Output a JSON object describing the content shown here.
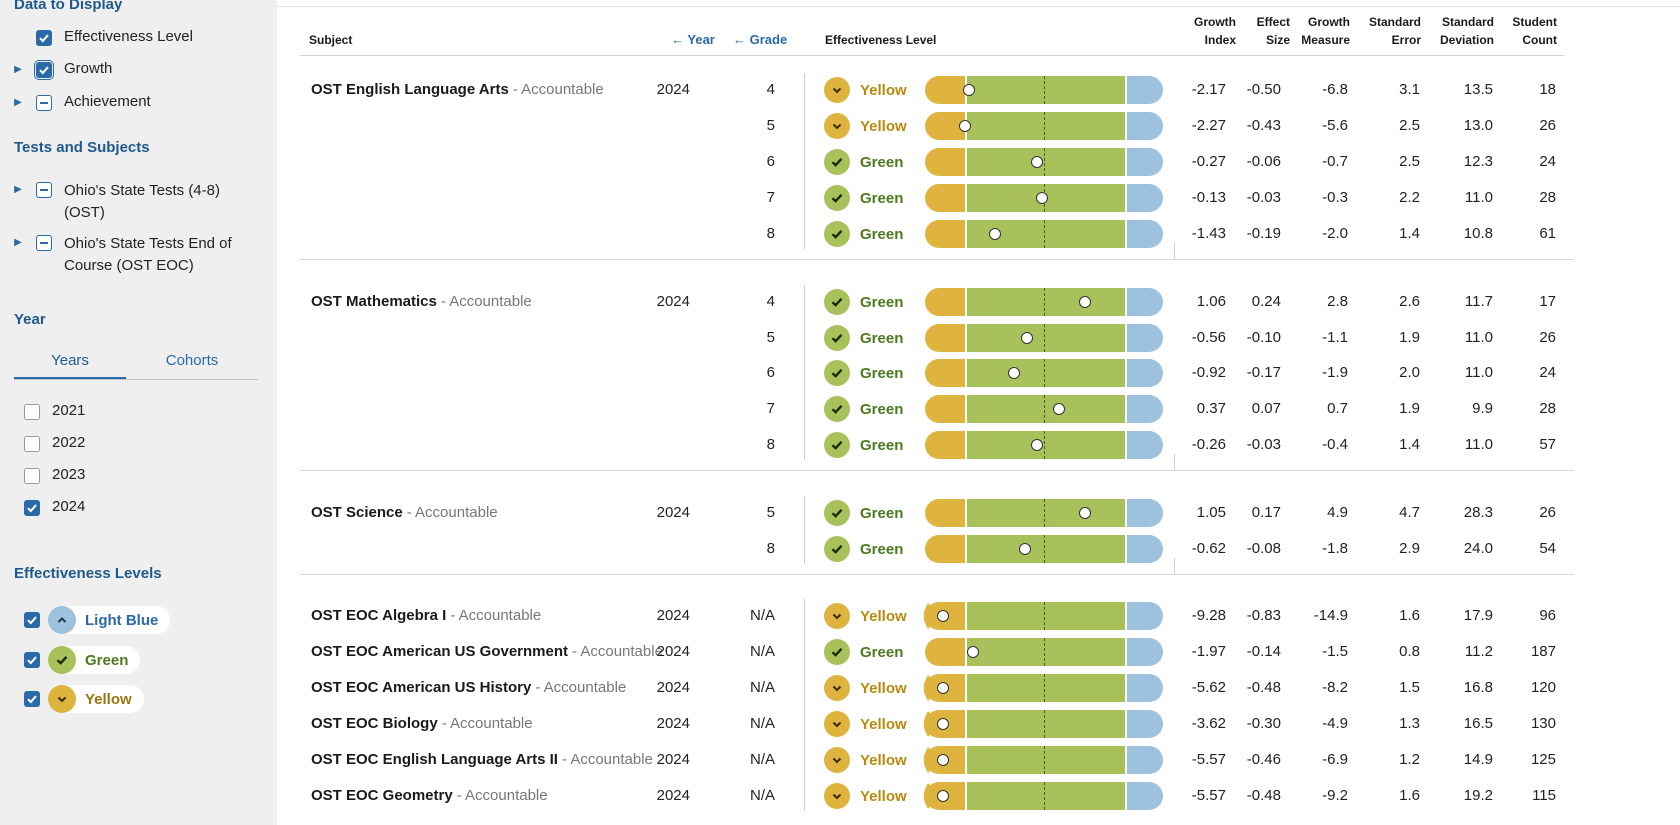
{
  "colors": {
    "yellow": "#deb43e",
    "green": "#a9c15b",
    "light_blue": "#9ec1de",
    "accent": "#2b6aa8",
    "heading": "#1f5a8e",
    "yellow_text": "#b88a10",
    "green_text": "#4d7a1e"
  },
  "sidebar": {
    "data_display": {
      "heading": "Data to Display",
      "items": [
        {
          "label": "Effectiveness Level",
          "checked": true,
          "expandable": false
        },
        {
          "label": "Growth",
          "checked": true,
          "expandable": true
        },
        {
          "label": "Achievement",
          "checked": false,
          "expandable": true
        }
      ]
    },
    "tests_subjects": {
      "heading": "Tests and Subjects",
      "items": [
        {
          "label_line1": "Ohio's State Tests (4-8)",
          "label_line2": "(OST)"
        },
        {
          "label_line1": "Ohio's State Tests End of",
          "label_line2": "Course (OST EOC)"
        }
      ]
    },
    "year": {
      "heading": "Year",
      "tabs": [
        "Years",
        "Cohorts"
      ],
      "active_tab": "Years",
      "options": [
        {
          "label": "2021",
          "checked": false
        },
        {
          "label": "2022",
          "checked": false
        },
        {
          "label": "2023",
          "checked": false
        },
        {
          "label": "2024",
          "checked": true
        }
      ]
    },
    "effectiveness_levels": {
      "heading": "Effectiveness Levels",
      "items": [
        {
          "label": "Light Blue",
          "icon": "chevron-up-icon"
        },
        {
          "label": "Green",
          "icon": "check-icon"
        },
        {
          "label": "Yellow",
          "icon": "chevron-down-icon"
        }
      ]
    }
  },
  "table": {
    "headers": {
      "subject": "Subject",
      "year": "Year",
      "grade": "Grade",
      "effectiveness": "Effectiveness Level",
      "growth_index": [
        "Growth",
        "Index"
      ],
      "effect_size": [
        "Effect",
        "Size"
      ],
      "growth_measure": [
        "Growth",
        "Measure"
      ],
      "standard_error": [
        "Standard",
        "Error"
      ],
      "standard_deviation": [
        "Standard",
        "Deviation"
      ],
      "student_count": [
        "Student",
        "Count"
      ]
    },
    "rows": [
      {
        "subject": "OST English Language Arts",
        "acc": "- Accountable",
        "year": "2024",
        "grade": "4",
        "level": "Yellow",
        "gi": "-2.17",
        "es": "-0.50",
        "gm": "-6.8",
        "se": "3.1",
        "sd": "13.5",
        "n": "18",
        "marker": 0.14
      },
      {
        "subject": "",
        "acc": "",
        "year": "",
        "grade": "5",
        "level": "Yellow",
        "gi": "-2.27",
        "es": "-0.43",
        "gm": "-5.6",
        "se": "2.5",
        "sd": "13.0",
        "n": "26",
        "marker": 0.12
      },
      {
        "subject": "",
        "acc": "",
        "year": "",
        "grade": "6",
        "level": "Green",
        "gi": "-0.27",
        "es": "-0.06",
        "gm": "-0.7",
        "se": "2.5",
        "sd": "12.3",
        "n": "24",
        "marker": 0.46
      },
      {
        "subject": "",
        "acc": "",
        "year": "",
        "grade": "7",
        "level": "Green",
        "gi": "-0.13",
        "es": "-0.03",
        "gm": "-0.3",
        "se": "2.2",
        "sd": "11.0",
        "n": "28",
        "marker": 0.48
      },
      {
        "subject": "",
        "acc": "",
        "year": "",
        "grade": "8",
        "level": "Green",
        "gi": "-1.43",
        "es": "-0.19",
        "gm": "-2.0",
        "se": "1.4",
        "sd": "10.8",
        "n": "61",
        "marker": 0.26
      },
      {
        "subject": "OST Mathematics",
        "acc": "- Accountable",
        "year": "2024",
        "grade": "4",
        "level": "Green",
        "gi": "1.06",
        "es": "0.24",
        "gm": "2.8",
        "se": "2.6",
        "sd": "11.7",
        "n": "17",
        "marker": 0.68
      },
      {
        "subject": "",
        "acc": "",
        "year": "",
        "grade": "5",
        "level": "Green",
        "gi": "-0.56",
        "es": "-0.10",
        "gm": "-1.1",
        "se": "1.9",
        "sd": "11.0",
        "n": "26",
        "marker": 0.41
      },
      {
        "subject": "",
        "acc": "",
        "year": "",
        "grade": "6",
        "level": "Green",
        "gi": "-0.92",
        "es": "-0.17",
        "gm": "-1.9",
        "se": "2.0",
        "sd": "11.0",
        "n": "24",
        "marker": 0.35
      },
      {
        "subject": "",
        "acc": "",
        "year": "",
        "grade": "7",
        "level": "Green",
        "gi": "0.37",
        "es": "0.07",
        "gm": "0.7",
        "se": "1.9",
        "sd": "9.9",
        "n": "28",
        "marker": 0.56
      },
      {
        "subject": "",
        "acc": "",
        "year": "",
        "grade": "8",
        "level": "Green",
        "gi": "-0.26",
        "es": "-0.03",
        "gm": "-0.4",
        "se": "1.4",
        "sd": "11.0",
        "n": "57",
        "marker": 0.46
      },
      {
        "subject": "OST Science",
        "acc": "- Accountable",
        "year": "2024",
        "grade": "5",
        "level": "Green",
        "gi": "1.05",
        "es": "0.17",
        "gm": "4.9",
        "se": "4.7",
        "sd": "28.3",
        "n": "26",
        "marker": 0.68
      },
      {
        "subject": "",
        "acc": "",
        "year": "",
        "grade": "8",
        "level": "Green",
        "gi": "-0.62",
        "es": "-0.08",
        "gm": "-1.8",
        "se": "2.9",
        "sd": "24.0",
        "n": "54",
        "marker": 0.4
      },
      {
        "subject": "OST EOC Algebra I",
        "acc": "- Accountable",
        "year": "2024",
        "grade": "N/A",
        "level": "Yellow",
        "gi": "-9.28",
        "es": "-0.83",
        "gm": "-14.9",
        "se": "1.6",
        "sd": "17.9",
        "n": "96",
        "marker": 0.02
      },
      {
        "subject": "OST EOC American US Government",
        "acc": "- Accountable",
        "year": "2024",
        "grade": "N/A",
        "level": "Green",
        "gi": "-1.97",
        "es": "-0.14",
        "gm": "-1.5",
        "se": "0.8",
        "sd": "11.2",
        "n": "187",
        "marker": 0.16
      },
      {
        "subject": "OST EOC American US History",
        "acc": "- Accountable",
        "year": "2024",
        "grade": "N/A",
        "level": "Yellow",
        "gi": "-5.62",
        "es": "-0.48",
        "gm": "-8.2",
        "se": "1.5",
        "sd": "16.8",
        "n": "120",
        "marker": 0.02
      },
      {
        "subject": "OST EOC Biology",
        "acc": "- Accountable",
        "year": "2024",
        "grade": "N/A",
        "level": "Yellow",
        "gi": "-3.62",
        "es": "-0.30",
        "gm": "-4.9",
        "se": "1.3",
        "sd": "16.5",
        "n": "130",
        "marker": 0.02
      },
      {
        "subject": "OST EOC English Language Arts II",
        "acc": "- Accountable",
        "year": "2024",
        "grade": "N/A",
        "level": "Yellow",
        "gi": "-5.57",
        "es": "-0.46",
        "gm": "-6.9",
        "se": "1.2",
        "sd": "14.9",
        "n": "125",
        "marker": 0.02
      },
      {
        "subject": "OST EOC Geometry",
        "acc": "- Accountable",
        "year": "2024",
        "grade": "N/A",
        "level": "Yellow",
        "gi": "-5.57",
        "es": "-0.48",
        "gm": "-9.2",
        "se": "1.6",
        "sd": "19.2",
        "n": "115",
        "marker": 0.02
      }
    ]
  }
}
